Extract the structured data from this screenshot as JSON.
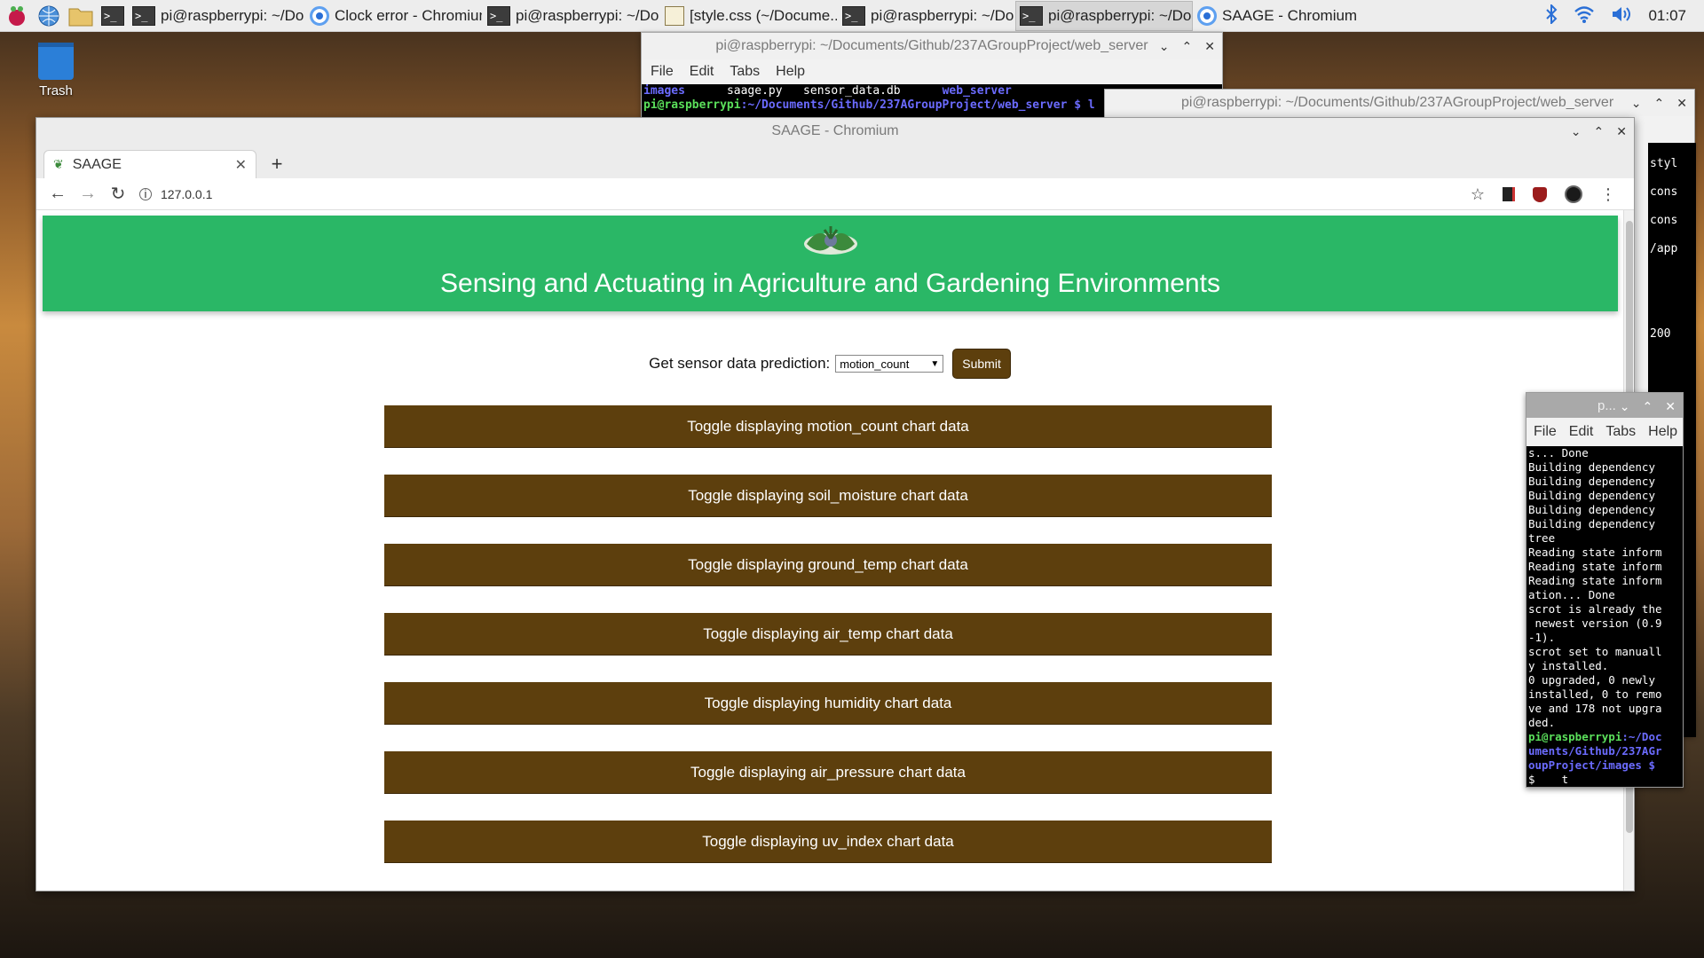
{
  "taskbar": {
    "tasks": [
      {
        "label": "pi@raspberrypi: ~/Do...",
        "icon": "terminal-icon"
      },
      {
        "label": "Clock error - Chromium",
        "icon": "chromium-icon"
      },
      {
        "label": "pi@raspberrypi: ~/Do...",
        "icon": "terminal-icon"
      },
      {
        "label": "[style.css (~/Docume...",
        "icon": "text-editor-icon"
      },
      {
        "label": "pi@raspberrypi: ~/Do...",
        "icon": "terminal-icon"
      },
      {
        "label": "pi@raspberrypi: ~/Do...",
        "icon": "terminal-icon"
      },
      {
        "label": "SAAGE - Chromium",
        "icon": "chromium-icon"
      }
    ],
    "clock": "01:07"
  },
  "desktop": {
    "trash_label": "Trash"
  },
  "terminal_back": {
    "title": "pi@raspberrypi: ~/Documents/Github/237AGroupProject/web_server",
    "menu": [
      "File",
      "Edit",
      "Tabs",
      "Help"
    ],
    "ls_images": "images",
    "ls_saage": "saage.py",
    "ls_db": "sensor_data.db",
    "ls_webserver": "web_server",
    "prompt_user": "pi@raspberrypi",
    "prompt_path": ":~/Documents/Github/237AGroupProject/web_server $ l"
  },
  "terminal_mid": {
    "title": "pi@raspberrypi: ~/Documents/Github/237AGroupProject/web_server",
    "lines": [
      "styl",
      "cons",
      "cons",
      "/app",
      "",
      "",
      "200"
    ]
  },
  "browser": {
    "window_title": "SAAGE - Chromium",
    "tab_title": "SAAGE",
    "url": "127.0.0.1",
    "page": {
      "header_title": "Sensing and Actuating in Agriculture and Gardening Environments",
      "prediction_label": "Get sensor data prediction:",
      "prediction_selected": "motion_count",
      "submit_label": "Submit",
      "toggles": [
        "Toggle displaying motion_count chart data",
        "Toggle displaying soil_moisture chart data",
        "Toggle displaying ground_temp chart data",
        "Toggle displaying air_temp chart data",
        "Toggle displaying humidity chart data",
        "Toggle displaying air_pressure chart data",
        "Toggle displaying uv_index chart data"
      ]
    }
  },
  "terminal_small": {
    "title": "p...",
    "menu": [
      "File",
      "Edit",
      "Tabs",
      "Help"
    ],
    "lines": [
      "s... Done",
      "Building dependency",
      "Building dependency",
      "Building dependency",
      "Building dependency",
      "Building dependency",
      "tree",
      "Reading state inform",
      "Reading state inform",
      "Reading state inform",
      "ation... Done",
      "scrot is already the",
      " newest version (0.9",
      "-1).",
      "scrot set to manuall",
      "y installed.",
      "0 upgraded, 0 newly",
      "installed, 0 to remo",
      "ve and 178 not upgra",
      "ded."
    ],
    "prompt_user": "pi@raspberrypi",
    "prompt_path": ":~/Doc\numents/Github/237AGr\noupProject/images $",
    "last_line": "$    t"
  },
  "colors": {
    "hero_green": "#2ab766",
    "button_brown": "#5d3f0d"
  }
}
